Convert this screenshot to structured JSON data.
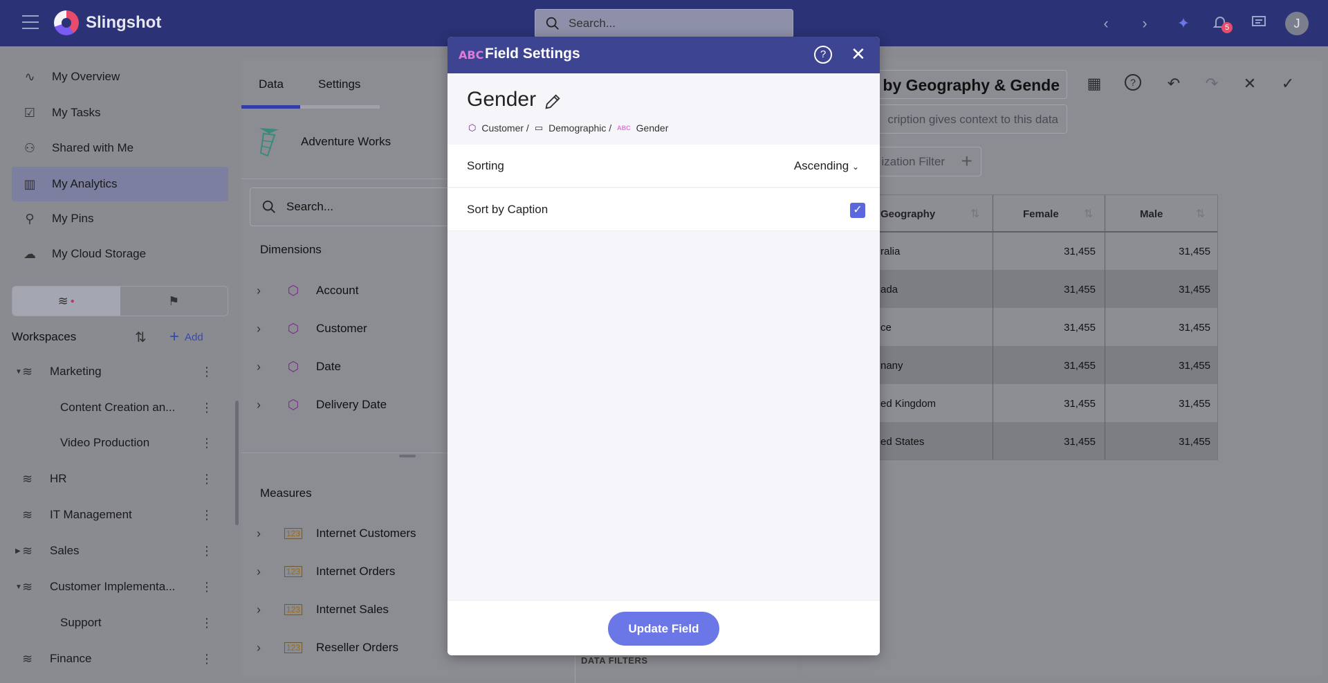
{
  "app": {
    "name": "Slingshot",
    "search_placeholder": "Search...",
    "notification_count": "5",
    "avatar_initial": "J"
  },
  "sidebar": {
    "nav": [
      {
        "label": "My Overview",
        "icon": "activity-icon"
      },
      {
        "label": "My Tasks",
        "icon": "clipboard-check-icon"
      },
      {
        "label": "Shared with Me",
        "icon": "users-icon"
      },
      {
        "label": "My Analytics",
        "icon": "bar-chart-icon",
        "active": true
      },
      {
        "label": "My Pins",
        "icon": "pin-icon"
      },
      {
        "label": "My Cloud Storage",
        "icon": "cloud-icon"
      }
    ],
    "workspaces_title": "Workspaces",
    "add_label": "Add",
    "workspaces": [
      {
        "label": "Marketing",
        "expanded": true
      },
      {
        "label": "Content Creation an...",
        "child": true
      },
      {
        "label": "Video Production",
        "child": true
      },
      {
        "label": "HR"
      },
      {
        "label": "IT Management"
      },
      {
        "label": "Sales",
        "collapsed": true
      },
      {
        "label": "Customer Implementa...",
        "expanded": true
      },
      {
        "label": "Support",
        "child": true
      },
      {
        "label": "Finance"
      }
    ]
  },
  "data_panel": {
    "tabs": [
      "Data",
      "Settings"
    ],
    "source_name": "Adventure Works",
    "search_placeholder": "Search...",
    "dimensions_title": "Dimensions",
    "dimensions": [
      "Account",
      "Customer",
      "Date",
      "Delivery Date"
    ],
    "measures_title": "Measures",
    "measures": [
      "Internet Customers",
      "Internet Orders",
      "Internet Sales",
      "Reseller Orders"
    ],
    "data_filters_label": "DATA FILTERS"
  },
  "viz": {
    "title_partial": "by Geography & Gende",
    "description_partial": "cription gives context to this data",
    "filter_partial": "ization Filter",
    "grid": {
      "headers": [
        "Geography",
        "Female",
        "Male"
      ],
      "rows": [
        [
          "ralia",
          "31,455",
          "31,455"
        ],
        [
          "ada",
          "31,455",
          "31,455"
        ],
        [
          "ce",
          "31,455",
          "31,455"
        ],
        [
          "nany",
          "31,455",
          "31,455"
        ],
        [
          "ed Kingdom",
          "31,455",
          "31,455"
        ],
        [
          "ed States",
          "31,455",
          "31,455"
        ]
      ]
    }
  },
  "modal": {
    "type_badge": "ABC",
    "title": "Field Settings",
    "field_name": "Gender",
    "breadcrumb": [
      "Customer /",
      "Demographic /",
      "Gender"
    ],
    "sorting_label": "Sorting",
    "sorting_value": "Ascending",
    "sort_by_caption_label": "Sort by Caption",
    "sort_by_caption_checked": true,
    "update_button": "Update Field"
  }
}
